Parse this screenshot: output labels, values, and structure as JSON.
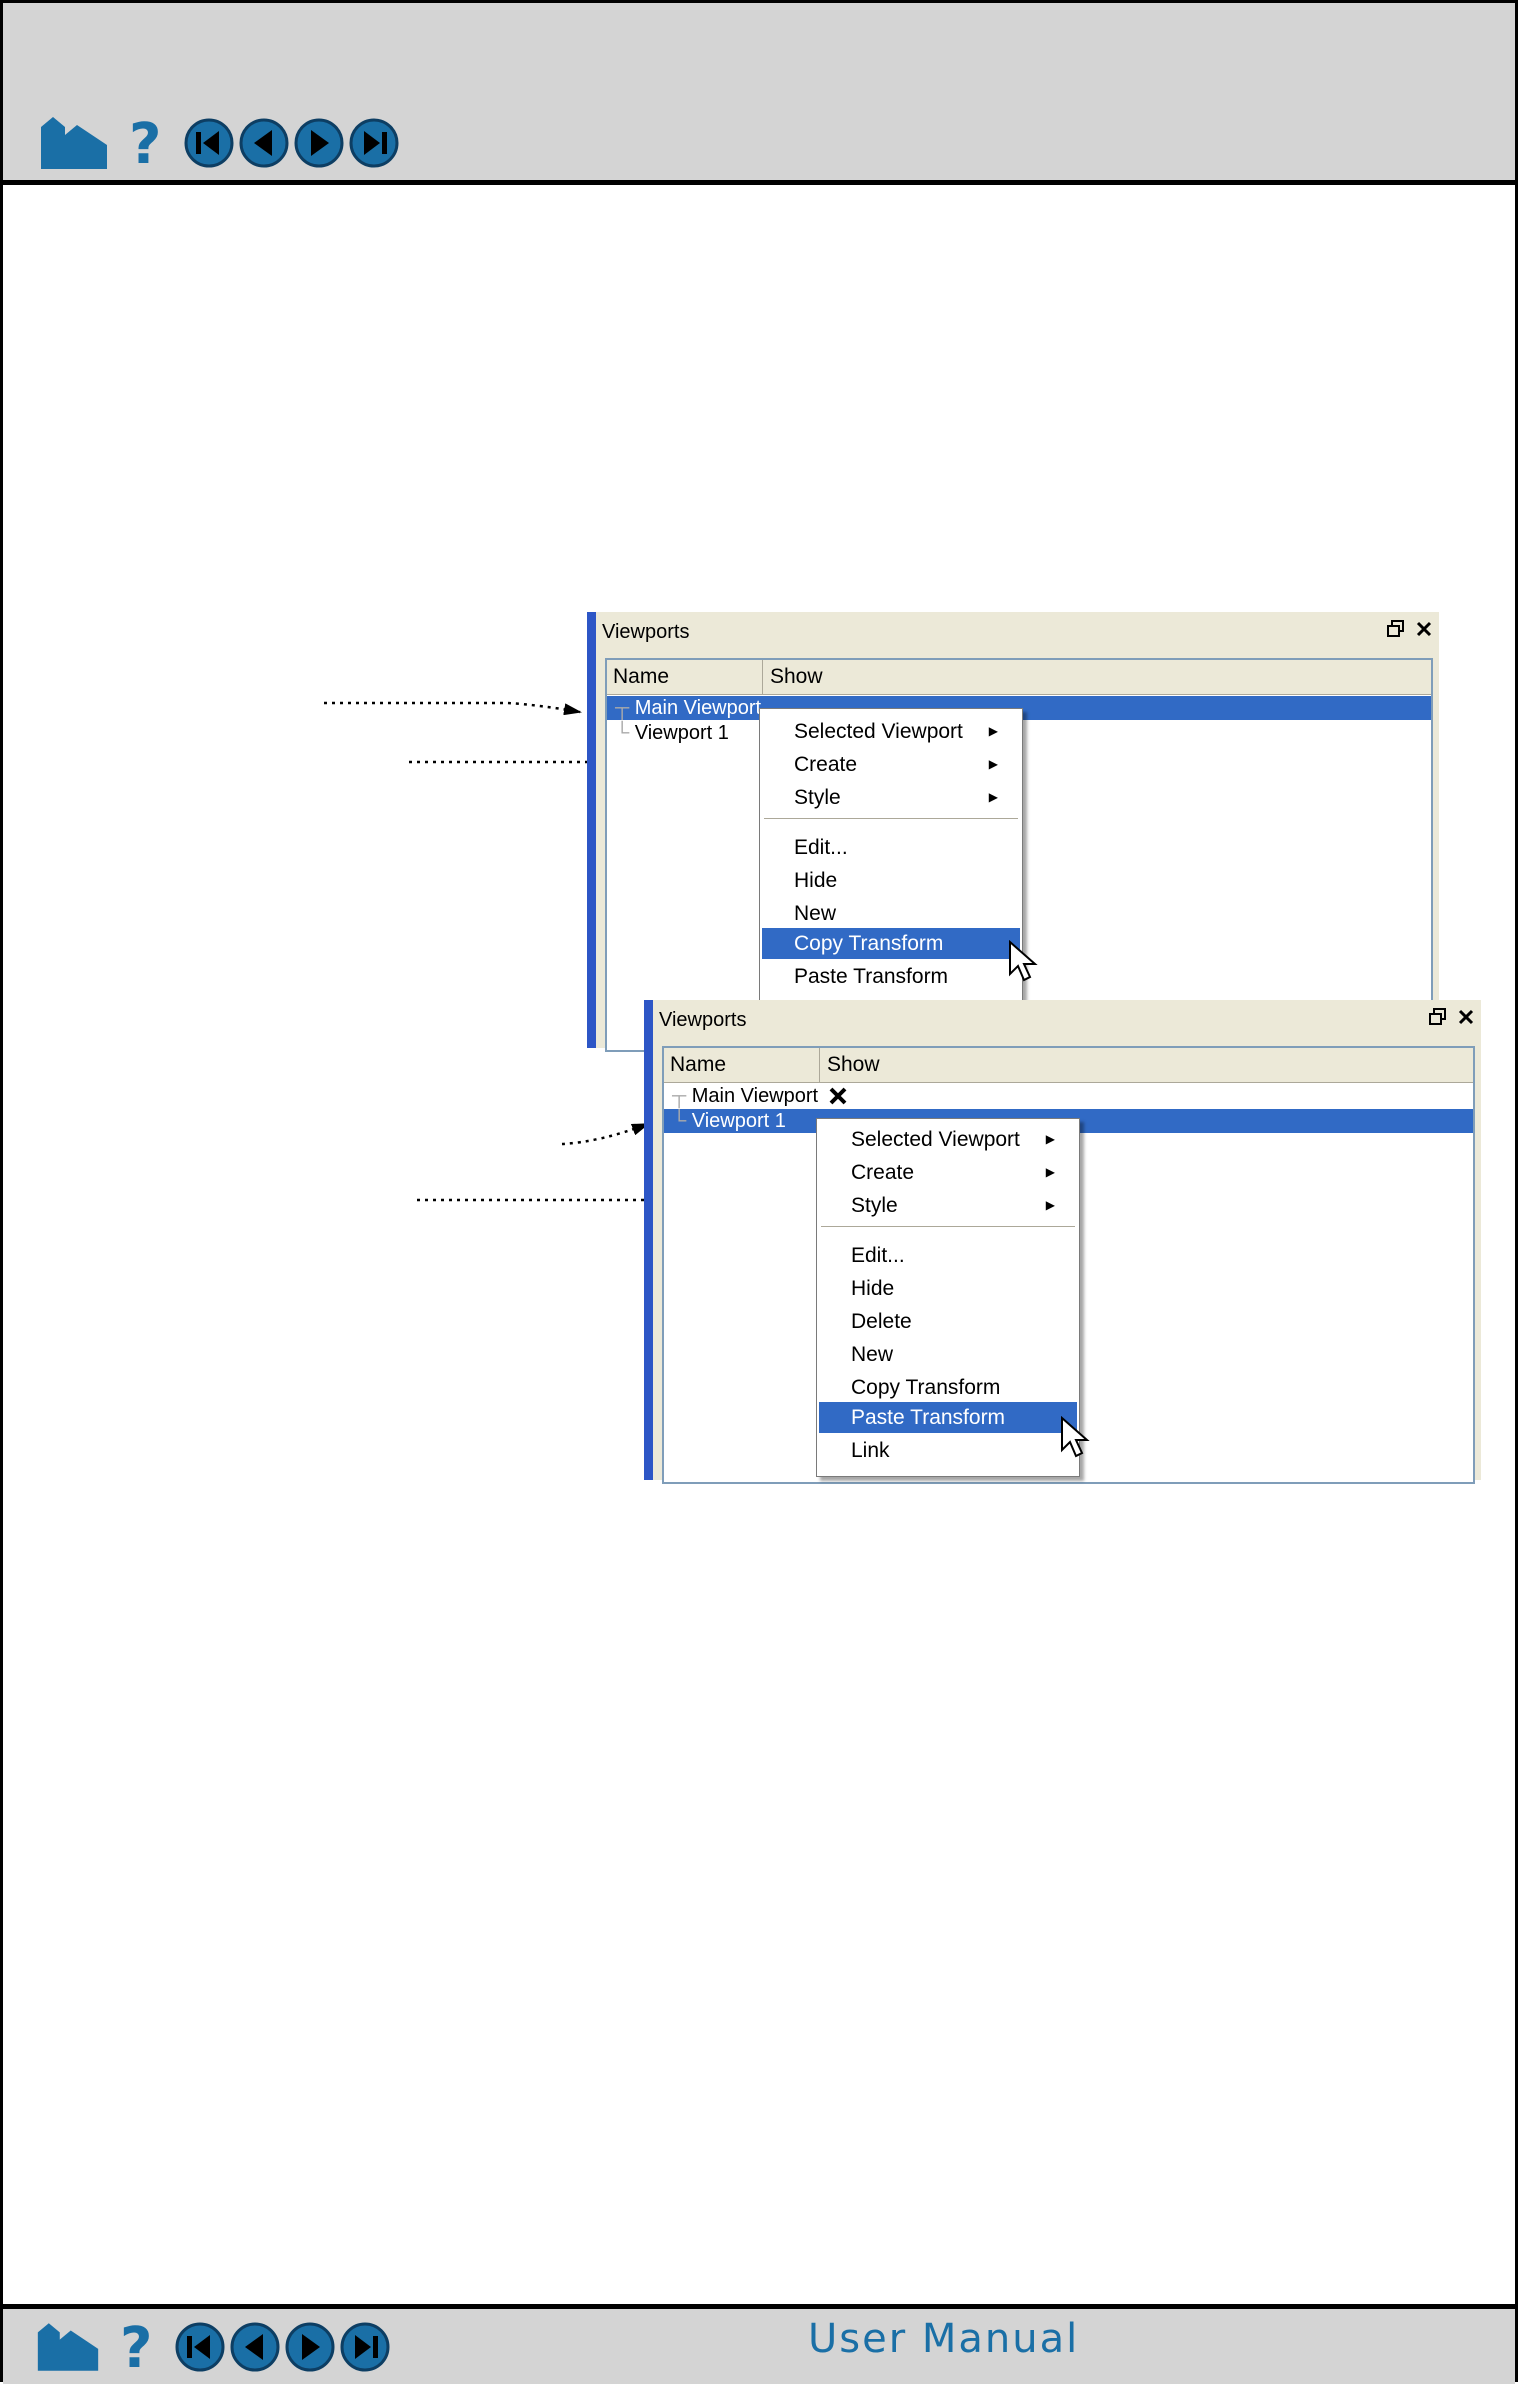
{
  "footer": {
    "manual_label": "User Manual"
  },
  "nav_icons": [
    "home-icon",
    "help-icon",
    "first-page-icon",
    "previous-page-icon",
    "next-page-icon",
    "last-page-icon"
  ],
  "colors": {
    "nav_blue": "#1a6fa6",
    "selection": "#316ac5",
    "panel_border": "#2d56c6"
  },
  "panel1": {
    "title": "Viewports",
    "col_name": "Name",
    "col_show": "Show",
    "rows": [
      "Main Viewport",
      "Viewport 1"
    ],
    "menu": [
      "Selected Viewport",
      "Create",
      "Style",
      "Edit...",
      "Hide",
      "New",
      "Copy Transform",
      "Paste Transform"
    ],
    "highlighted": "Copy Transform"
  },
  "panel2": {
    "title": "Viewports",
    "col_name": "Name",
    "col_show": "Show",
    "rows": [
      "Main Viewport",
      "Viewport 1"
    ],
    "menu": [
      "Selected Viewport",
      "Create",
      "Style",
      "Edit...",
      "Hide",
      "Delete",
      "New",
      "Copy Transform",
      "Paste Transform",
      "Link"
    ],
    "highlighted": "Paste Transform"
  }
}
